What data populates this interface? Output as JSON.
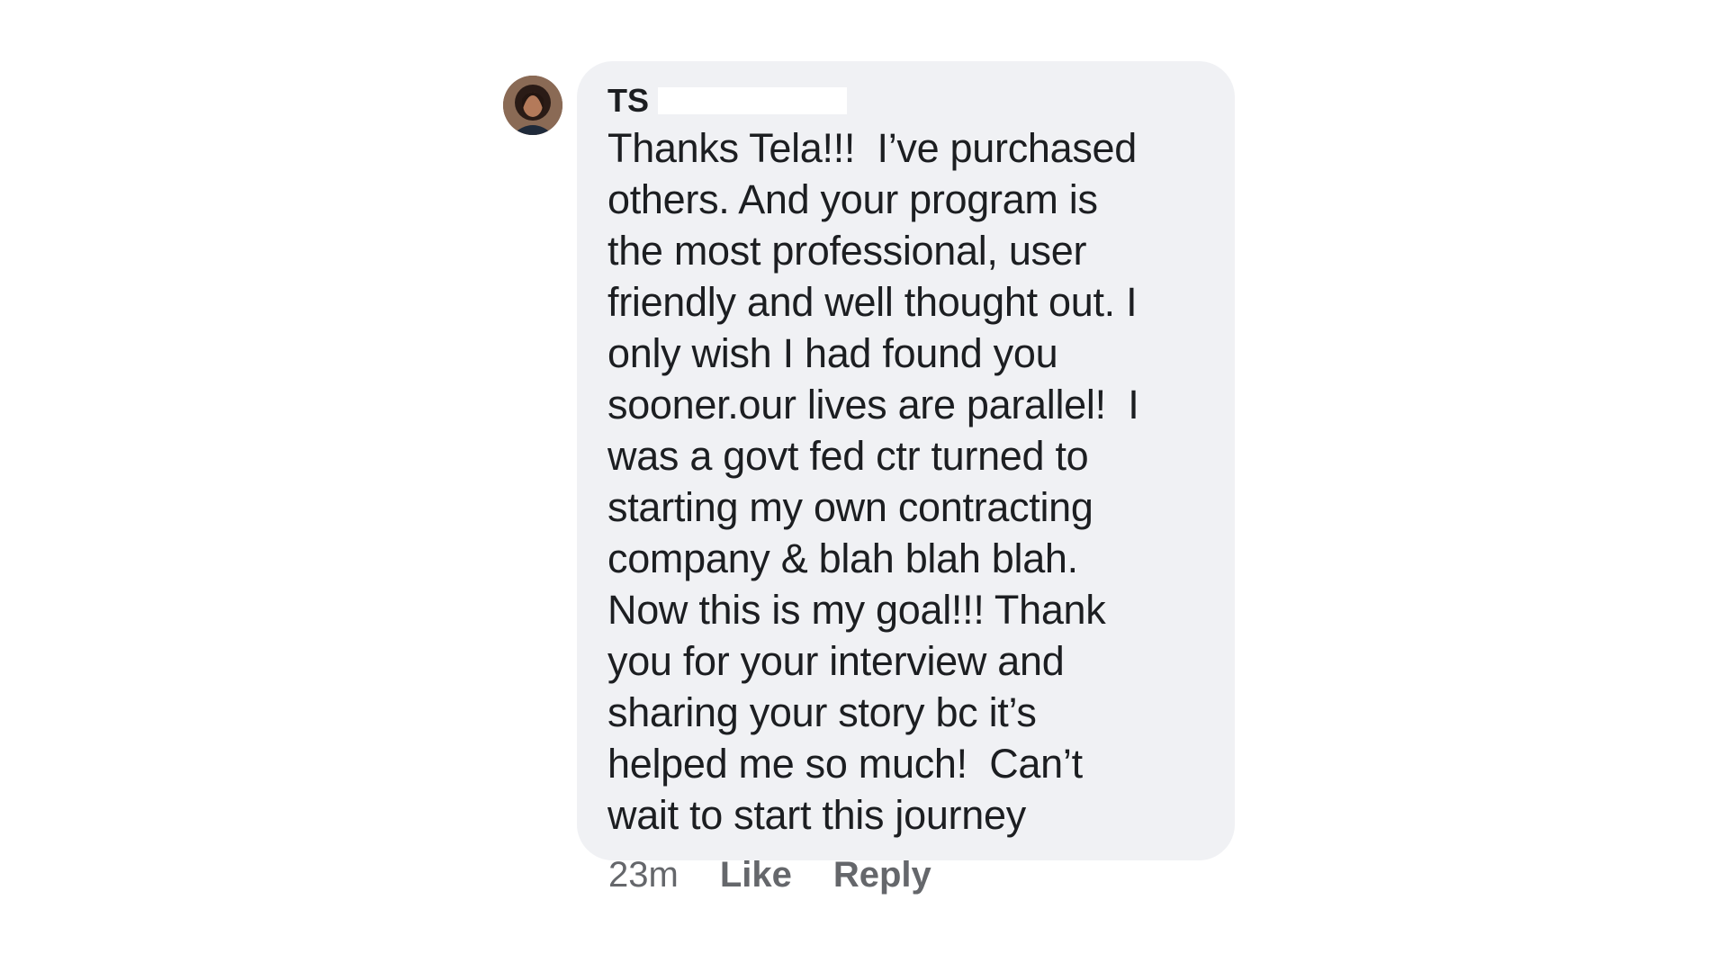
{
  "comment": {
    "author_name": "TS",
    "text_lines": [
      "Thanks Tela!!!  I’ve purchased",
      "others. And your program is",
      "the most professional, user",
      "friendly and well thought out. I",
      "only wish I had found you",
      "sooner.our lives are parallel!  I",
      "was a govt fed ctr turned to",
      "starting my own contracting",
      "company & blah blah blah.",
      "Now this is my goal!!! Thank",
      "you for your interview and",
      "sharing your story bc it’s",
      "helped me so much!  Can’t",
      "wait to start this journey"
    ],
    "timestamp": "23m",
    "like_label": "Like",
    "reply_label": "Reply"
  },
  "colors": {
    "bubble_background": "#f0f1f4",
    "text": "#1c1e21",
    "meta_text": "#65676b"
  }
}
